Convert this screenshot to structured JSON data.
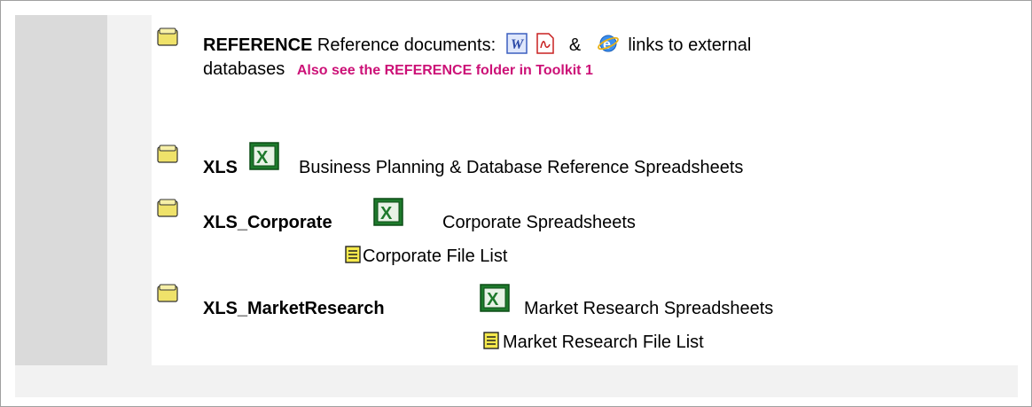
{
  "entries": {
    "reference": {
      "name": "REFERENCE",
      "desc": "Reference documents:",
      "amp": "&",
      "links_text": "links to external",
      "line2": "databases",
      "note": "Also see the REFERENCE folder in Toolkit 1"
    },
    "xls": {
      "name": "XLS",
      "desc": "Business Planning & Database Reference Spreadsheets"
    },
    "xls_corporate": {
      "name": "XLS_Corporate",
      "desc": "Corporate Spreadsheets",
      "file_list": "Corporate File List"
    },
    "xls_marketresearch": {
      "name": "XLS_MarketResearch",
      "desc": "Market Research Spreadsheets",
      "file_list": "Market Research File List"
    }
  },
  "icons": {
    "folder": "folder-icon",
    "word": "word-doc-icon",
    "pdf": "pdf-icon",
    "ie": "internet-explorer-icon",
    "excel": "excel-icon",
    "text_file": "text-file-icon"
  },
  "colors": {
    "note": "#cc1177",
    "gutter": "#dadada",
    "panel": "#f2f2f2",
    "folder_fill": "#efe26a",
    "excel_green": "#1e7a2c"
  }
}
